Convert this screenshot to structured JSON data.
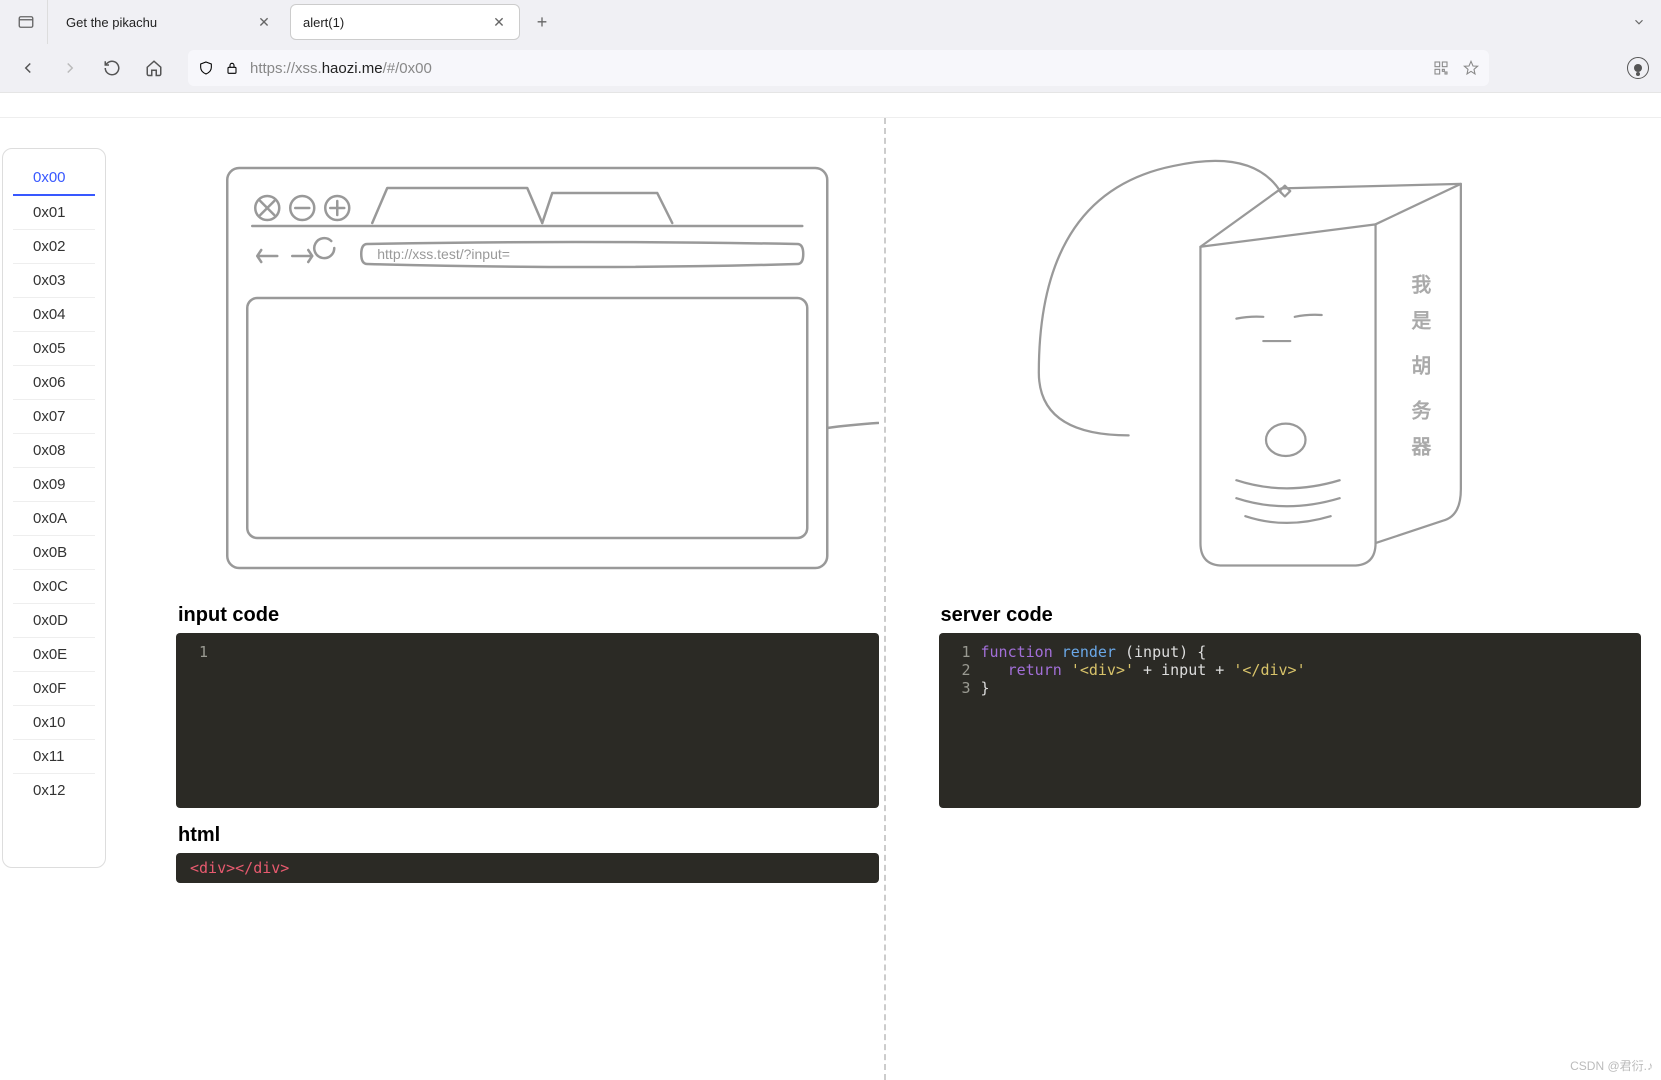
{
  "browser": {
    "tabs": [
      {
        "label": "Get the pikachu",
        "active": false
      },
      {
        "label": "alert(1)",
        "active": true
      }
    ],
    "url_prefix": "https://xss.",
    "url_host": "haozi.me",
    "url_suffix": "/#/0x00"
  },
  "sidebar": {
    "items": [
      "0x00",
      "0x01",
      "0x02",
      "0x03",
      "0x04",
      "0x05",
      "0x06",
      "0x07",
      "0x08",
      "0x09",
      "0x0A",
      "0x0B",
      "0x0C",
      "0x0D",
      "0x0E",
      "0x0F",
      "0x10",
      "0x11",
      "0x12"
    ],
    "active": "0x00"
  },
  "sketch": {
    "url_placeholder": "http://xss.test/?input=",
    "server_label_chars": [
      "我",
      "是",
      "胡",
      "务",
      "器"
    ]
  },
  "left": {
    "input_title": "input code",
    "input_lines": [
      ""
    ],
    "html_title": "html",
    "html_code": "<div></div>"
  },
  "right": {
    "server_title": "server code",
    "server_code": {
      "l1_kw": "function",
      "l1_fn": "render",
      "l1_rest": " (input) {",
      "l2_kw": "return",
      "l2_s1": "'<div>'",
      "l2_op1": " + ",
      "l2_var": "input",
      "l2_op2": " + ",
      "l2_s2": "'</div>'",
      "l3": "}"
    }
  },
  "watermark": "CSDN @君衍.♪"
}
